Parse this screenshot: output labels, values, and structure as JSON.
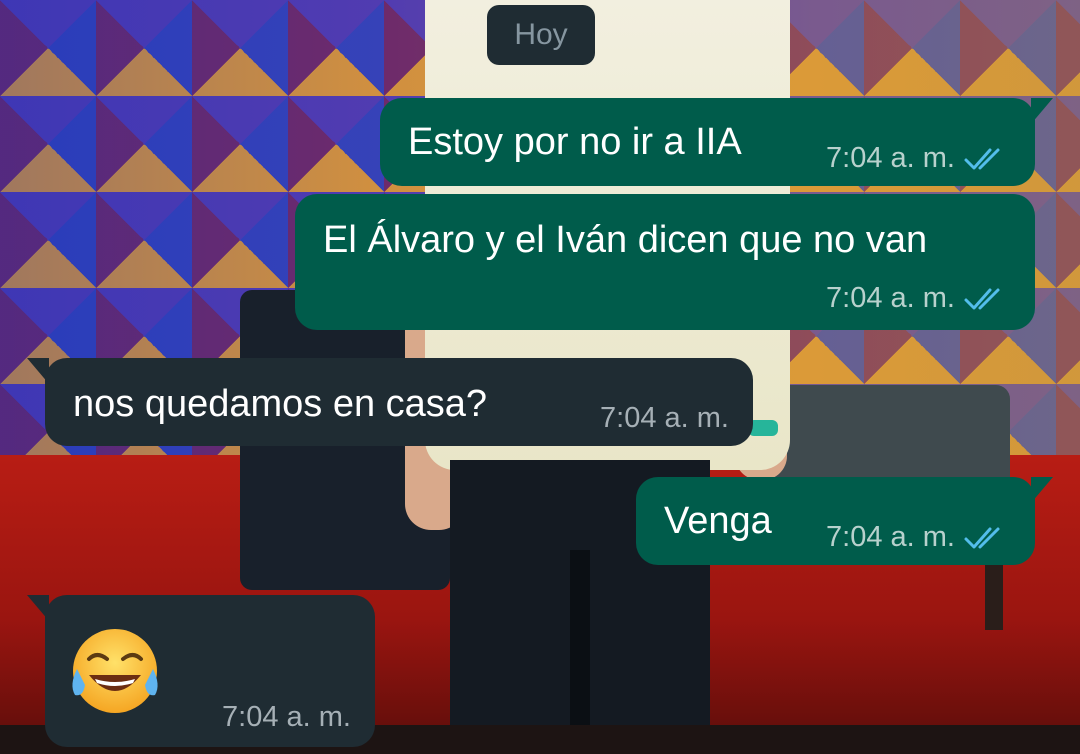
{
  "conversation": {
    "date_label": "Hoy",
    "messages": [
      {
        "text": "Estoy por no ir a IIA",
        "time": "7:04 a. m.",
        "direction": "outgoing",
        "status": "read-icon"
      },
      {
        "text": "El Álvaro y el Iván dicen que no van",
        "time": "7:04 a. m.",
        "direction": "outgoing",
        "status": "read-icon"
      },
      {
        "text": "nos quedamos en casa?",
        "time": "7:04 a. m.",
        "direction": "incoming"
      },
      {
        "text": "Venga",
        "time": "7:04 a. m.",
        "direction": "outgoing",
        "status": "read-icon"
      },
      {
        "text": "",
        "emoji": "face-with-tears-of-joy-icon",
        "time": "7:04 a. m.",
        "direction": "incoming"
      }
    ]
  },
  "colors": {
    "outgoing_bubble": "#005c4b",
    "incoming_bubble": "#1f2c33",
    "read_ticks": "#53bdeb",
    "date_chip": "#1f2c33"
  }
}
